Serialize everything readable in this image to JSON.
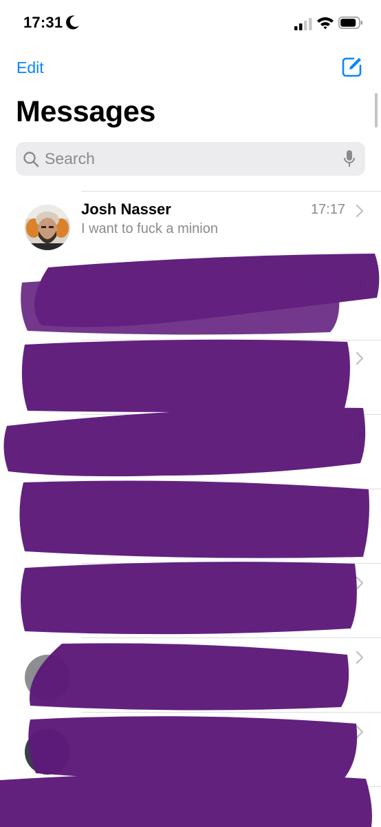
{
  "status_bar": {
    "time": "17:31",
    "icons": [
      "moon-icon",
      "cellular-signal-icon",
      "wifi-icon",
      "battery-icon"
    ]
  },
  "nav": {
    "edit_label": "Edit",
    "compose_icon": "compose-icon",
    "title": "Messages"
  },
  "search": {
    "placeholder": "Search",
    "icons": [
      "search-icon",
      "microphone-icon"
    ]
  },
  "conversations": [
    {
      "name": "Josh Nasser",
      "preview": "I want to fuck a minion",
      "time": "17:17"
    }
  ],
  "colors": {
    "accent": "#0a84ff",
    "redaction": "#5e1a7a",
    "secondary_text": "#8a8a8e",
    "search_bg": "#ececee"
  }
}
